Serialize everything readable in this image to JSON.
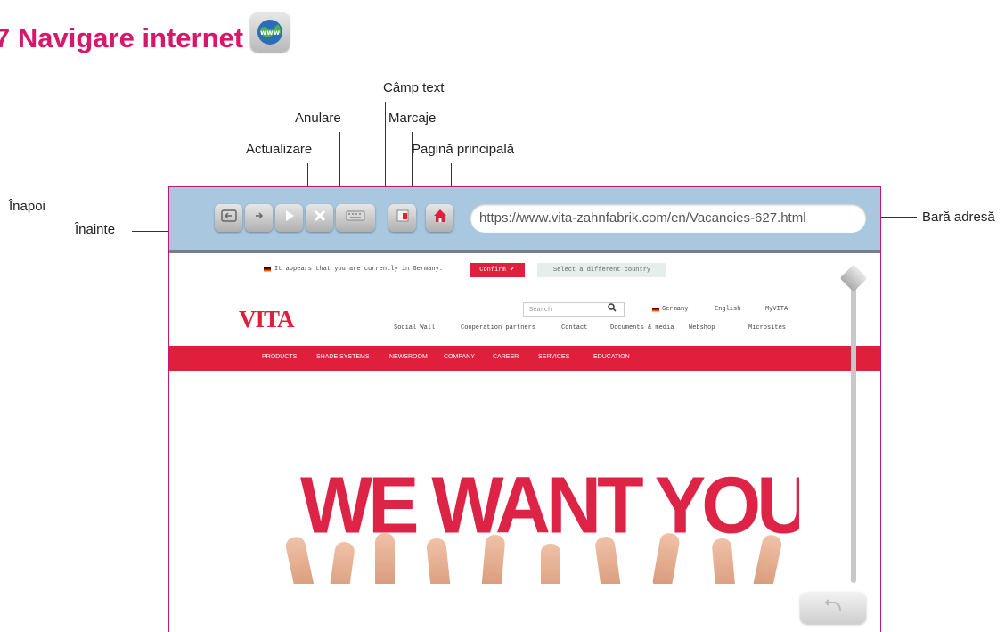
{
  "heading": {
    "title": "7 Navigare internet",
    "icon": "www-globe-icon"
  },
  "callouts": {
    "back": "Înapoi",
    "forward": "Înainte",
    "refresh": "Actualizare",
    "cancel": "Anulare",
    "text_field": "Câmp text",
    "bookmarks": "Marcaje",
    "home": "Pagină principală",
    "address_bar": "Bară adresă"
  },
  "browser": {
    "address": "https://www.vita-zahnfabrik.com/en/Vacancies-627.html",
    "buttons": [
      "back-arrow-icon",
      "forward-arrow-icon",
      "play-icon",
      "close-x-icon",
      "keyboard-icon",
      "bookmark-icon",
      "home-icon"
    ]
  },
  "site": {
    "notice": "It appears that you are currently in Germany.",
    "confirm": "Confirm ✔",
    "select_country": "Select a different country",
    "logo": "VITA",
    "search_placeholder": "Search",
    "lang_country": "Germany",
    "lang": "English",
    "myvita": "MyVITA",
    "top_links": [
      "Social Wall",
      "Cooperation partners",
      "Contact",
      "Documents & media",
      "Webshop",
      "Microsites"
    ],
    "nav": [
      "PRODUCTS",
      "SHADE SYSTEMS",
      "NEWSROOM",
      "COMPANY",
      "CAREER",
      "SERVICES",
      "EDUCATION"
    ],
    "banner": "WE WANT YOU"
  },
  "colors": {
    "heading": "#d6186b",
    "toolbar": "#a9c7df",
    "vita_red": "#e01f3d"
  }
}
